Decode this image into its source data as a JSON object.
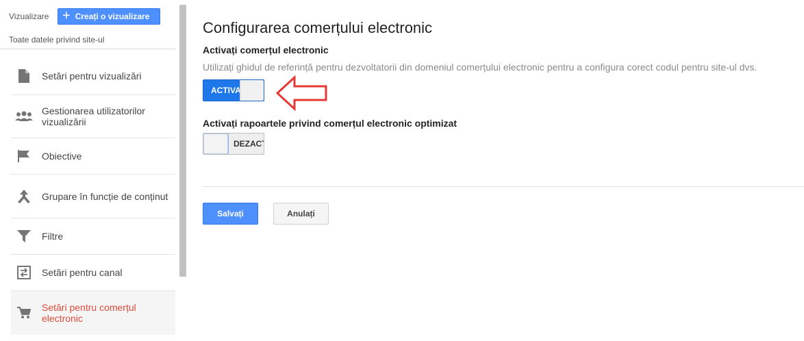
{
  "sidebar": {
    "view_label": "Vizualizare",
    "create_button": "Creați o vizualizare",
    "all_site_data": "Toate datele privind site-ul",
    "items": [
      {
        "label": "Setări pentru vizualizări",
        "icon": "document-icon"
      },
      {
        "label": "Gestionarea utilizatorilor vizualizării",
        "icon": "users-icon"
      },
      {
        "label": "Obiective",
        "icon": "flag-icon"
      },
      {
        "label": "Grupare în funcție de conținut",
        "icon": "content-grouping-icon"
      },
      {
        "label": "Filtre",
        "icon": "filter-icon"
      },
      {
        "label": "Setări pentru canal",
        "icon": "channel-settings-icon"
      },
      {
        "label": "Setări pentru comerțul electronic",
        "icon": "cart-icon",
        "active": true
      }
    ]
  },
  "main": {
    "title": "Configurarea comerțului electronic",
    "ecommerce": {
      "title": "Activați comerțul electronic",
      "help": "Utilizați ghidul de referință pentru dezvoltatorii din domeniul comerțului electronic pentru a configura corect codul pentru site-ul dvs.",
      "toggle_label": "ACTIVA",
      "enabled": true
    },
    "enhanced": {
      "title": "Activați rapoartele privind comerțul electronic optimizat",
      "toggle_label": "DEZACT",
      "enabled": false
    },
    "save_button": "Salvați",
    "cancel_button": "Anulați"
  },
  "colors": {
    "accent": "#4d90fe",
    "active_nav": "#dd4b39",
    "annotation_arrow": "#e53935"
  }
}
